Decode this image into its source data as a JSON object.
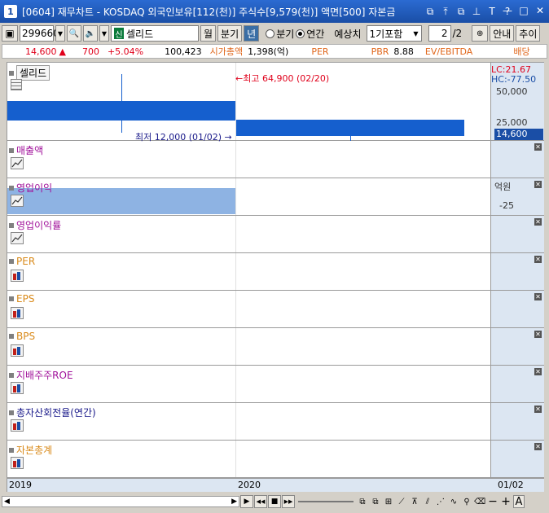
{
  "window": {
    "number": "1",
    "title": "[0604] 재무차트 - KOSDAQ 외국인보유[112(천)] 주식수[9,579(천)] 액면[500] 자본금",
    "icons": [
      "⧉",
      "⤒",
      "⧉",
      "⊥",
      "T",
      "?"
    ],
    "minimize": "—",
    "maximize": "□",
    "close": "✕"
  },
  "toolbar": {
    "code": "299660",
    "search_icon": "🔍",
    "speaker_icon": "🔈",
    "name_badge": "신",
    "stock_name": "셀리드",
    "btn_month": "월",
    "btn_quarter": "분기",
    "btn_year": "년",
    "radio_quarter": "분기",
    "radio_annual": "연간",
    "forecast_label": "예상치",
    "forecast_value": "1기포함",
    "page_current": "2",
    "page_total": "/2",
    "btn_guide": "안내",
    "btn_add": "추이"
  },
  "quote": {
    "price": "14,600",
    "arrow": "▲",
    "change": "700",
    "change_pct": "+5.04%",
    "volume": "100,423",
    "mktcap_label": "시가총액",
    "mktcap_value": "1,398(억)",
    "per_label": "PER",
    "pbr_label": "PBR",
    "pbr_value": "8.88",
    "ev_label": "EV/EBITDA",
    "div_label": "배당"
  },
  "price_pane": {
    "title": "셀리드",
    "high_note": "←최고 64,900 (02/20)",
    "low_note": "최저 12,000 (01/02) →",
    "lc": "LC:21.67",
    "hc": "HC:-77.50",
    "tick_50000": "50,000",
    "tick_25000": "25,000",
    "current_price": "14,600"
  },
  "panes": [
    {
      "key": "sales",
      "label": "매출액",
      "color": "#a0109a",
      "icon": "line-chart-icon"
    },
    {
      "key": "op_profit",
      "label": "영업이익",
      "color": "#a0109a",
      "icon": "line-chart-icon",
      "unit": "억원",
      "tick": "-25"
    },
    {
      "key": "op_margin",
      "label": "영업이익률",
      "color": "#a0109a",
      "icon": "line-chart-icon"
    },
    {
      "key": "per",
      "label": "PER",
      "color": "#d98a1a",
      "icon": "bar-chart-icon"
    },
    {
      "key": "eps",
      "label": "EPS",
      "color": "#d98a1a",
      "icon": "bar-chart-icon"
    },
    {
      "key": "bps",
      "label": "BPS",
      "color": "#d98a1a",
      "icon": "bar-chart-icon"
    },
    {
      "key": "roe",
      "label": "지배주주ROE",
      "color": "#a0109a",
      "icon": "bar-chart-icon"
    },
    {
      "key": "turnover",
      "label": "총자산회전율(연간)",
      "color": "#1a1a8a",
      "icon": "bar-chart-icon"
    },
    {
      "key": "equity",
      "label": "자본총계",
      "color": "#d98a1a",
      "icon": "bar-chart-icon"
    }
  ],
  "xaxis": {
    "labels": [
      "2019",
      "2020"
    ],
    "end_label": "01/02"
  },
  "bottom": {
    "scroll_left": "◀",
    "scroll_right": "▶",
    "play": "▶",
    "prev": "◀◀",
    "stop": "■",
    "next": "▶▶",
    "minus": "−",
    "plus": "+",
    "font": "A"
  }
}
